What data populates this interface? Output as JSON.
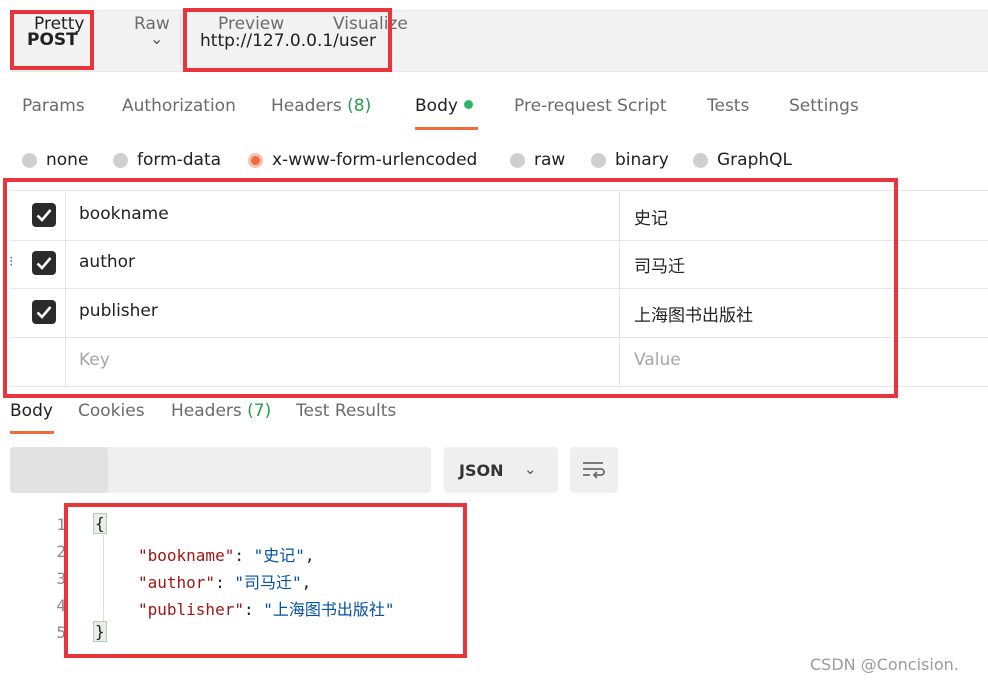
{
  "request": {
    "method": "POST",
    "url": "http://127.0.0.1/user"
  },
  "request_tabs": {
    "params": "Params",
    "authorization": "Authorization",
    "headers": "Headers",
    "headers_count": "(8)",
    "body": "Body",
    "prerequest": "Pre-request Script",
    "tests": "Tests",
    "settings": "Settings"
  },
  "body_types": {
    "none": "none",
    "form_data": "form-data",
    "urlencoded": "x-www-form-urlencoded",
    "raw": "raw",
    "binary": "binary",
    "graphql": "GraphQL",
    "selected": "x-www-form-urlencoded"
  },
  "params": [
    {
      "checked": true,
      "key": "bookname",
      "value": "史记"
    },
    {
      "checked": true,
      "key": "author",
      "value": "司马迁"
    },
    {
      "checked": true,
      "key": "publisher",
      "value": "上海图书出版社"
    }
  ],
  "params_placeholder": {
    "key": "Key",
    "value": "Value"
  },
  "response_tabs": {
    "body": "Body",
    "cookies": "Cookies",
    "headers": "Headers",
    "headers_count": "(7)",
    "test_results": "Test Results"
  },
  "view_modes": {
    "pretty": "Pretty",
    "raw": "Raw",
    "preview": "Preview",
    "visualize": "Visualize",
    "selected": "Pretty"
  },
  "format": "JSON",
  "response_code": {
    "line_numbers": [
      "1",
      "2",
      "3",
      "4",
      "5"
    ],
    "open_brace": "{",
    "close_brace": "}",
    "entries": [
      {
        "key": "\"bookname\"",
        "value": "\"史记\"",
        "trail": ","
      },
      {
        "key": "\"author\"",
        "value": "\"司马迁\"",
        "trail": ","
      },
      {
        "key": "\"publisher\"",
        "value": "\"上海图书出版社\"",
        "trail": ""
      }
    ]
  },
  "watermark": "CSDN @Concision.",
  "colors": {
    "accent": "#f26b3a",
    "highlight_box": "#e8343a",
    "count_green": "#2a9d4e",
    "json_key": "#a31515",
    "json_value": "#0451a5"
  }
}
